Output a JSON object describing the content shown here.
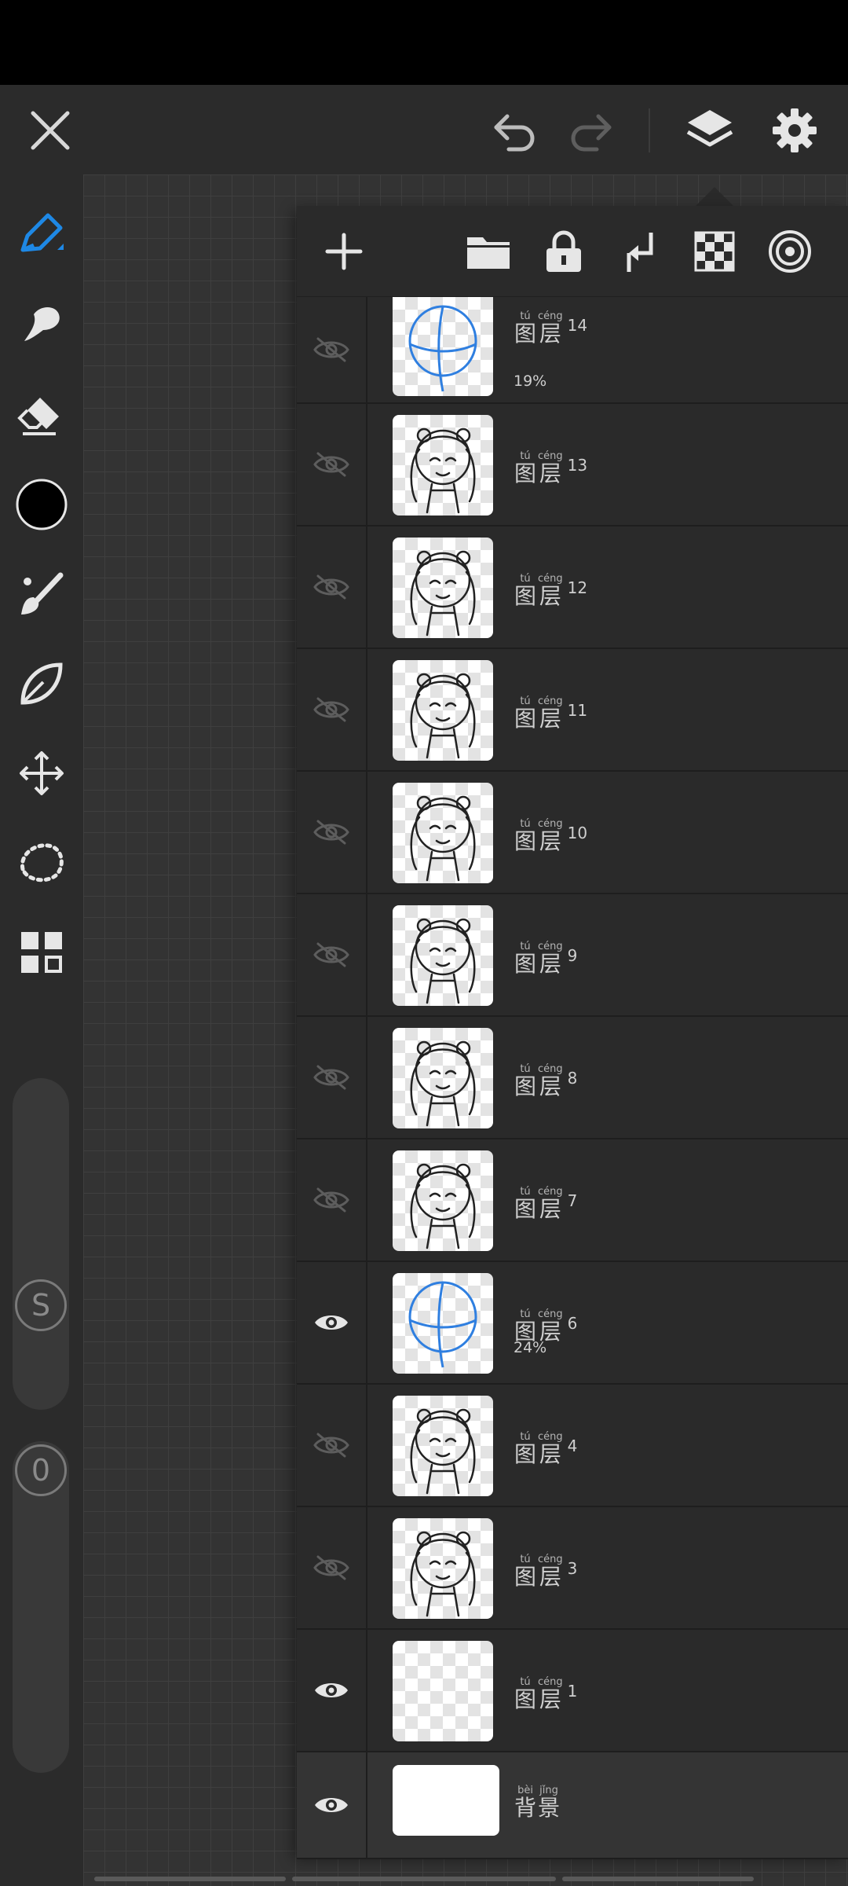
{
  "colors": {
    "accent": "#1e88e5",
    "current_color": "#000000"
  },
  "top_bar": {
    "close_icon": "close-icon",
    "undo_icon": "undo-icon",
    "redo_icon": "redo-icon",
    "layers_icon": "layers-icon",
    "settings_icon": "gear-icon"
  },
  "tools": [
    "pen",
    "smudge",
    "eraser",
    "color",
    "brush",
    "shape",
    "transform",
    "lasso",
    "more"
  ],
  "sliders": {
    "size_label": "S",
    "opacity_label": "0"
  },
  "layer_panel": {
    "actions": [
      "add-layer",
      "folder",
      "lock",
      "merge-down",
      "transparency",
      "reference"
    ],
    "layers": [
      {
        "label": "图层",
        "pinyin": [
          "tú",
          "céng"
        ],
        "number": "14",
        "opacity": "19%",
        "visible": false
      },
      {
        "label": "图层",
        "pinyin": [
          "tú",
          "céng"
        ],
        "number": "13",
        "visible": false
      },
      {
        "label": "图层",
        "pinyin": [
          "tú",
          "céng"
        ],
        "number": "12",
        "visible": false
      },
      {
        "label": "图层",
        "pinyin": [
          "tú",
          "céng"
        ],
        "number": "11",
        "visible": false
      },
      {
        "label": "图层",
        "pinyin": [
          "tú",
          "céng"
        ],
        "number": "10",
        "visible": false
      },
      {
        "label": "图层",
        "pinyin": [
          "tú",
          "céng"
        ],
        "number": "9",
        "visible": false
      },
      {
        "label": "图层",
        "pinyin": [
          "tú",
          "céng"
        ],
        "number": "8",
        "visible": false
      },
      {
        "label": "图层",
        "pinyin": [
          "tú",
          "céng"
        ],
        "number": "7",
        "visible": false
      },
      {
        "label": "图层",
        "pinyin": [
          "tú",
          "céng"
        ],
        "number": "6",
        "opacity": "24%",
        "visible": true
      },
      {
        "label": "图层",
        "pinyin": [
          "tú",
          "céng"
        ],
        "number": "4",
        "visible": false
      },
      {
        "label": "图层",
        "pinyin": [
          "tú",
          "céng"
        ],
        "number": "3",
        "visible": false
      },
      {
        "label": "图层",
        "pinyin": [
          "tú",
          "céng"
        ],
        "number": "1",
        "visible": true
      }
    ],
    "background": {
      "label": "背景",
      "pinyin": [
        "bèi",
        "jǐng"
      ],
      "visible": true
    }
  }
}
